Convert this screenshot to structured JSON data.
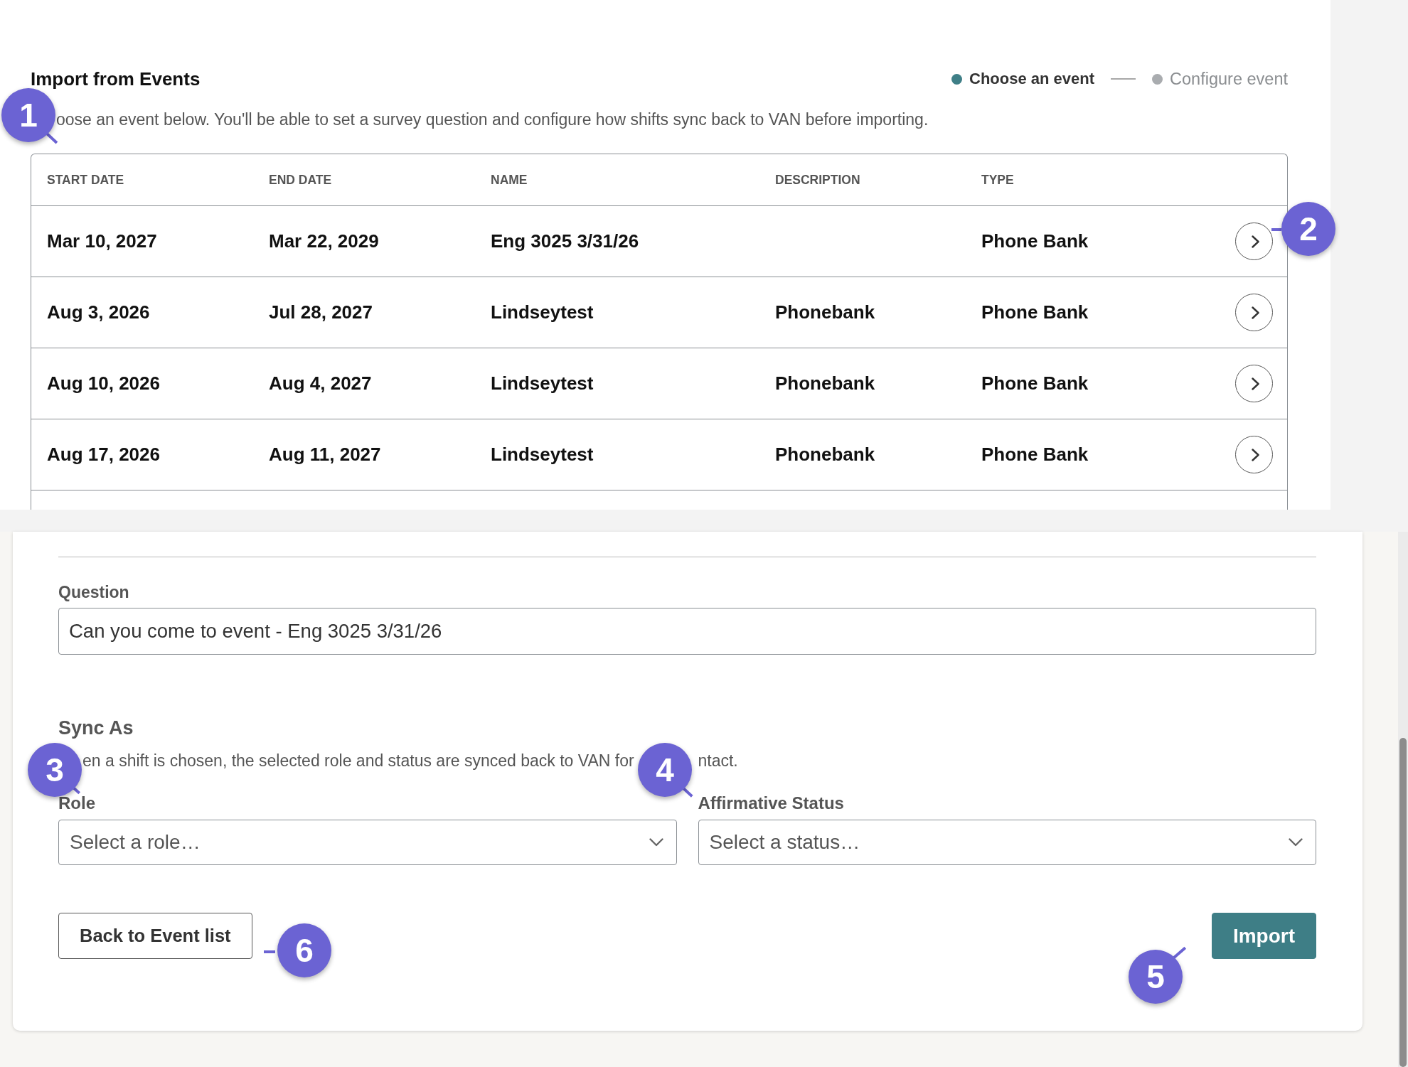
{
  "import_panel": {
    "title": "Import from Events",
    "description": "oose an event below. You'll be able to set a survey question and configure how shifts sync back to VAN before importing.",
    "steps": [
      {
        "label": "Choose an event",
        "selected": true
      },
      {
        "label": "Configure event",
        "selected": false
      }
    ],
    "table": {
      "columns": [
        "START DATE",
        "END DATE",
        "NAME",
        "DESCRIPTION",
        "TYPE"
      ],
      "rows": [
        {
          "start_date": "Mar 10, 2027",
          "end_date": "Mar 22, 2029",
          "name": "Eng 3025 3/31/26",
          "type": "Phone Bank"
        },
        {
          "start_date": "Aug 3, 2026",
          "end_date": "Jul 28, 2027",
          "name": "Lindseytest",
          "description": "Phonebank",
          "type": "Phone Bank"
        },
        {
          "start_date": "Aug 10, 2026",
          "end_date": "Aug 4, 2027",
          "name": "Lindseytest",
          "description": "Phonebank",
          "type": "Phone Bank"
        },
        {
          "start_date": "Aug 17, 2026",
          "end_date": "Aug 11, 2027",
          "name": "Lindseytest",
          "description": "Phonebank",
          "type": "Phone Bank"
        }
      ]
    }
  },
  "configure_panel": {
    "question": {
      "label": "Question",
      "value": "Can you come to event - Eng 3025 3/31/26"
    },
    "sync_as": {
      "heading": "Sync As",
      "description_parts": [
        "en a shift is chosen, the selected role and status are synced back to VAN for",
        "ntact."
      ]
    },
    "fields": [
      {
        "label": "Role",
        "placeholder": "Select a role…"
      },
      {
        "label": "Affirmative Status",
        "placeholder": "Select a status…"
      }
    ],
    "buttons": [
      {
        "label": "Back to Event list",
        "kind": "secondary"
      },
      {
        "label": "Import",
        "kind": "primary"
      }
    ]
  },
  "callouts": [
    {
      "label": "1"
    },
    {
      "label": "2"
    },
    {
      "label": "3"
    },
    {
      "label": "4"
    },
    {
      "label": "5"
    },
    {
      "label": "6"
    }
  ]
}
